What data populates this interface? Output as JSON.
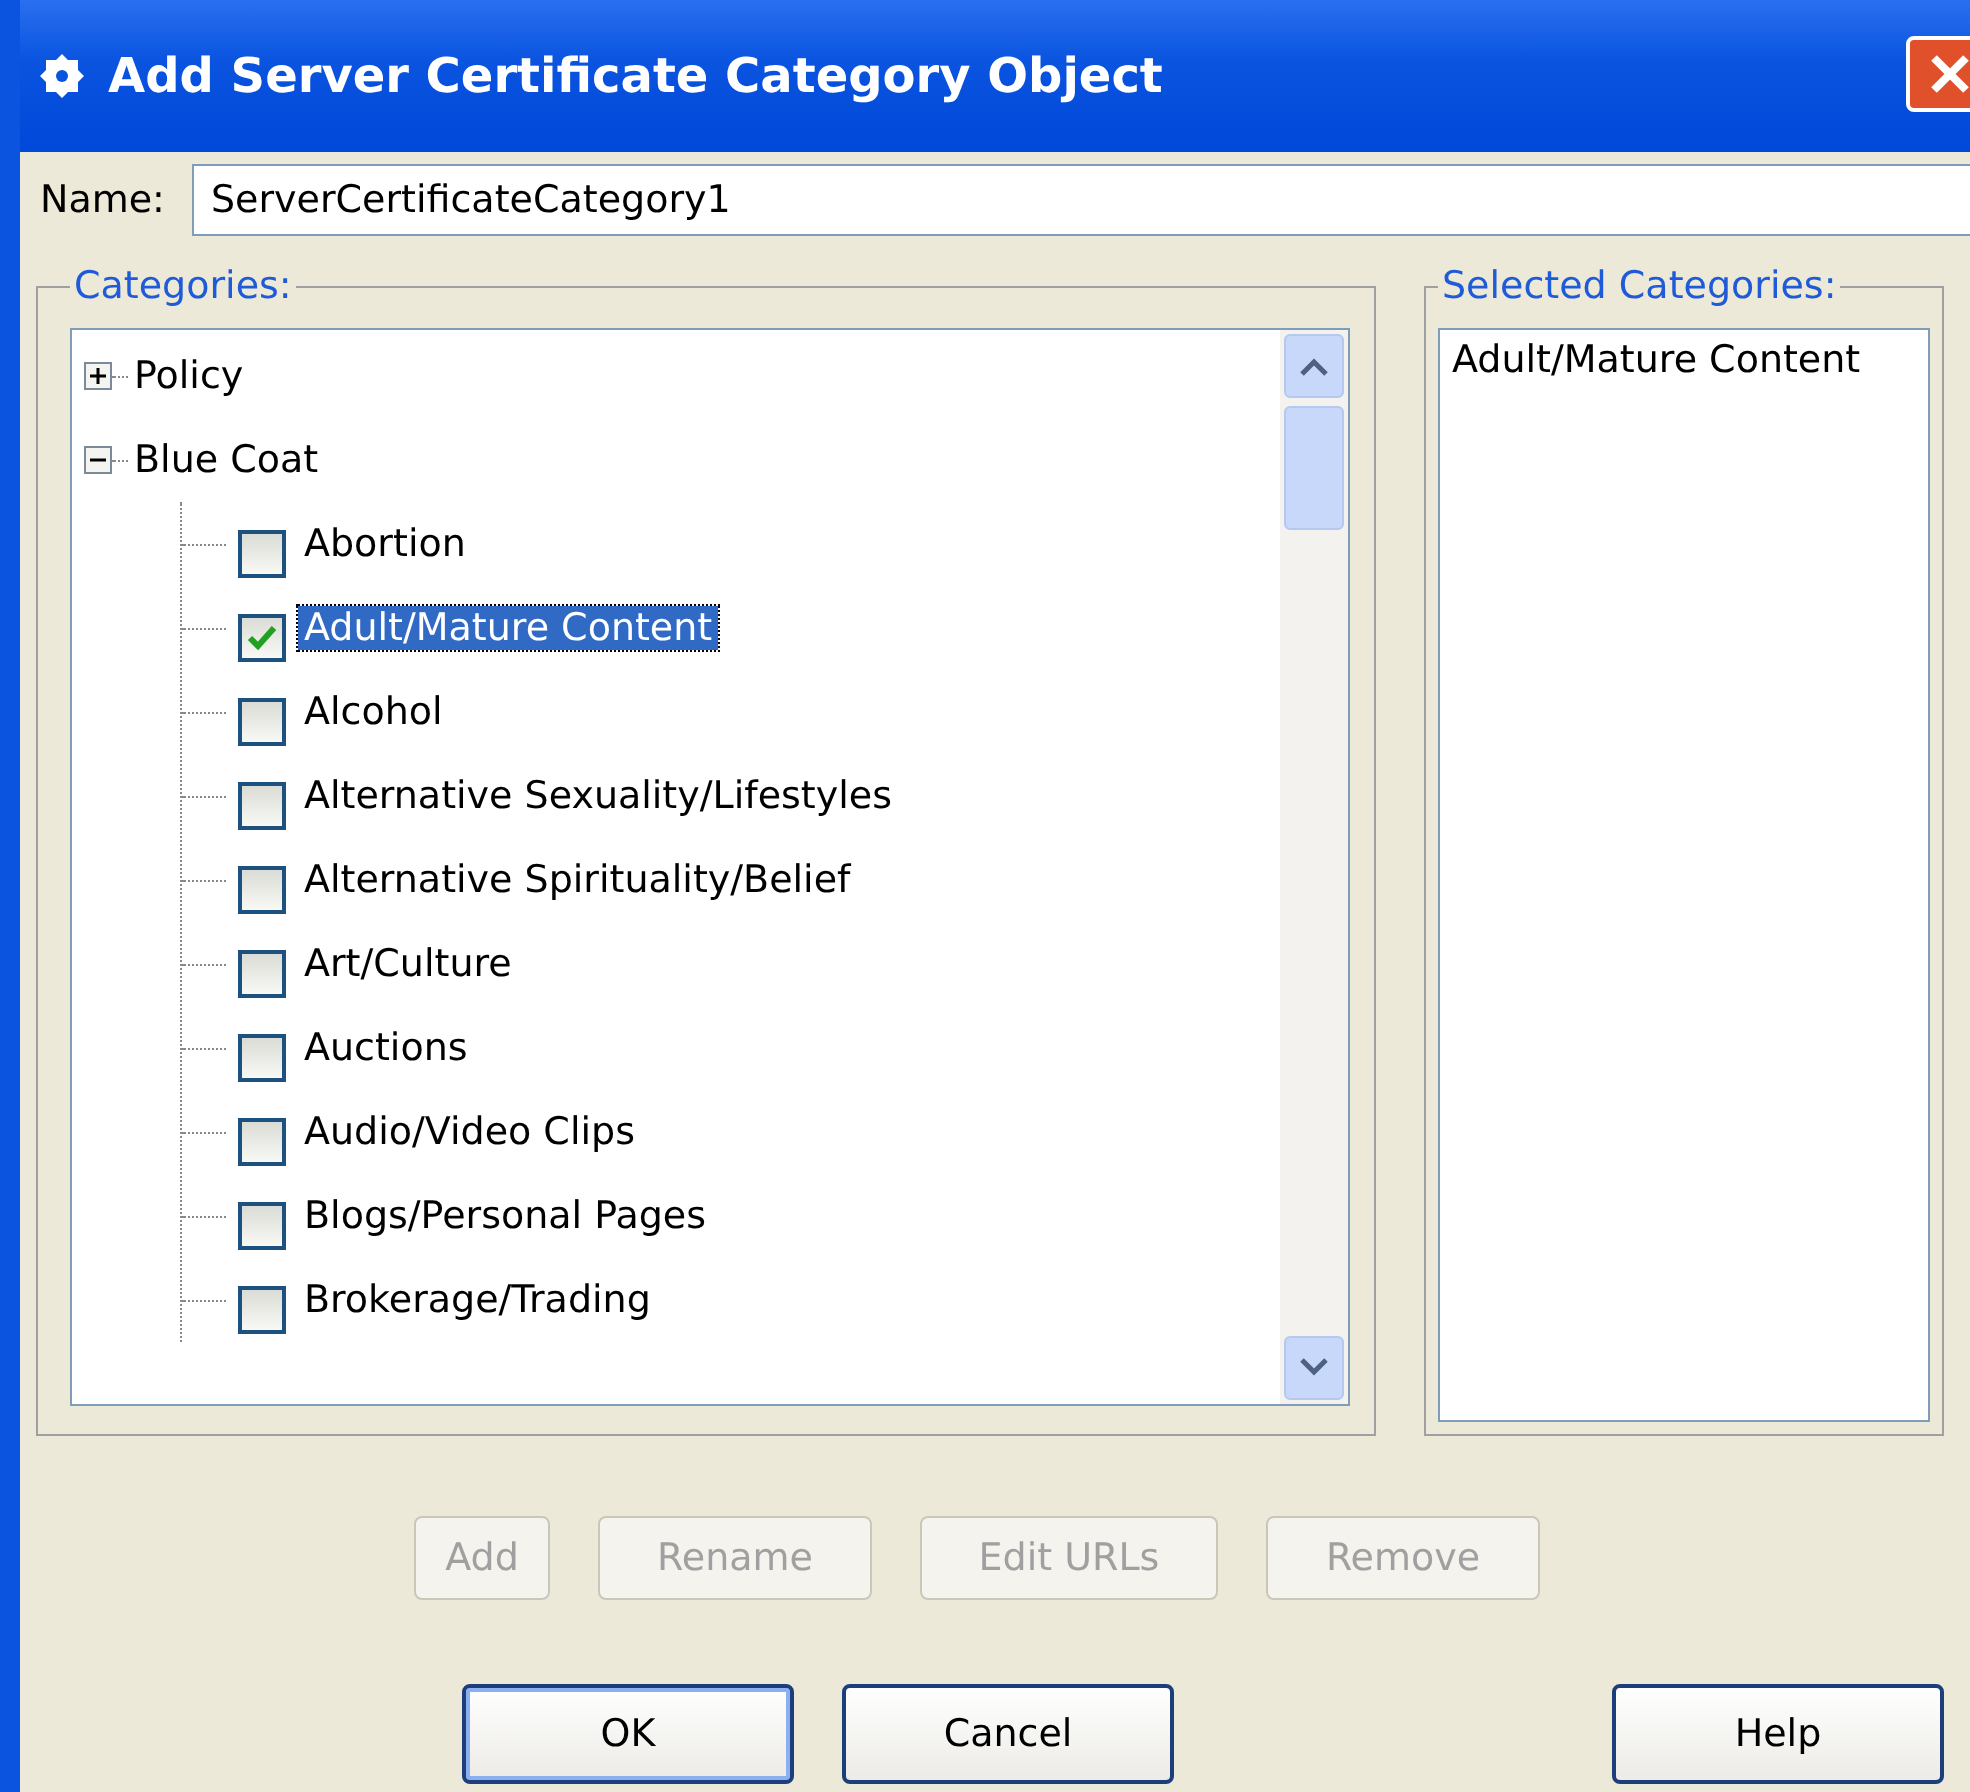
{
  "window": {
    "title": "Add Server Certificate Category Object"
  },
  "name_field": {
    "label": "Name:",
    "value": "ServerCertificateCategory1"
  },
  "categories": {
    "legend": "Categories:",
    "tree": [
      {
        "label": "Policy",
        "expanded": false
      },
      {
        "label": "Blue Coat",
        "expanded": true,
        "children": [
          {
            "label": "Abortion",
            "checked": false,
            "selected": false
          },
          {
            "label": "Adult/Mature Content",
            "checked": true,
            "selected": true
          },
          {
            "label": "Alcohol",
            "checked": false,
            "selected": false
          },
          {
            "label": "Alternative Sexuality/Lifestyles",
            "checked": false,
            "selected": false
          },
          {
            "label": "Alternative Spirituality/Belief",
            "checked": false,
            "selected": false
          },
          {
            "label": "Art/Culture",
            "checked": false,
            "selected": false
          },
          {
            "label": "Auctions",
            "checked": false,
            "selected": false
          },
          {
            "label": "Audio/Video Clips",
            "checked": false,
            "selected": false
          },
          {
            "label": "Blogs/Personal Pages",
            "checked": false,
            "selected": false
          },
          {
            "label": "Brokerage/Trading",
            "checked": false,
            "selected": false
          }
        ]
      }
    ]
  },
  "selected_categories": {
    "legend": "Selected Categories:",
    "items": [
      "Adult/Mature Content"
    ]
  },
  "action_buttons": [
    {
      "label": "Add",
      "disabled": true
    },
    {
      "label": "Rename",
      "disabled": true
    },
    {
      "label": "Edit URLs",
      "disabled": true
    },
    {
      "label": "Remove",
      "disabled": true
    }
  ],
  "dialog_buttons": [
    {
      "label": "OK",
      "default": true
    },
    {
      "label": "Cancel",
      "default": false
    },
    {
      "label": "Help",
      "default": false
    }
  ]
}
